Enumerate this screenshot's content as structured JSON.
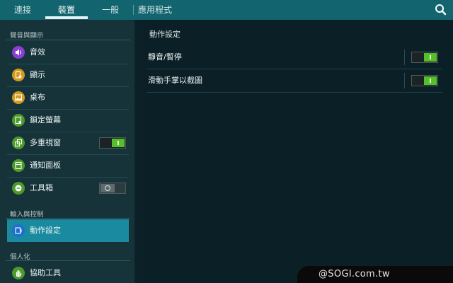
{
  "tabs": [
    {
      "label": "連接",
      "active": false
    },
    {
      "label": "裝置",
      "active": true
    },
    {
      "label": "一般",
      "active": false
    },
    {
      "label": "應用程式",
      "active": false
    }
  ],
  "search_icon": "search-icon",
  "sidebar": {
    "sections": [
      {
        "header": "聲音與顯示",
        "items": [
          {
            "label": "音效",
            "icon": "speaker-icon",
            "color": "#8a3fd1"
          },
          {
            "label": "顯示",
            "icon": "display-icon",
            "color": "#d49a1c"
          },
          {
            "label": "桌布",
            "icon": "wallpaper-icon",
            "color": "#d49a1c"
          },
          {
            "label": "鎖定螢幕",
            "icon": "lock-screen-icon",
            "color": "#4b9a2a"
          },
          {
            "label": "多重視窗",
            "icon": "multi-window-icon",
            "color": "#4b9a2a",
            "toggle": "on"
          },
          {
            "label": "通知面板",
            "icon": "notification-panel-icon",
            "color": "#4b9a2a"
          },
          {
            "label": "工具箱",
            "icon": "toolbox-icon",
            "color": "#4b9a2a",
            "toggle": "off"
          }
        ]
      },
      {
        "header": "輸入與控制",
        "items": [
          {
            "label": "動作設定",
            "icon": "motion-icon",
            "color": "#1f6fd1",
            "selected": true
          }
        ]
      },
      {
        "header": "個人化",
        "items": [
          {
            "label": "協助工具",
            "icon": "hand-icon",
            "color": "#4b9a2a"
          }
        ]
      }
    ]
  },
  "main": {
    "title": "動作設定",
    "rows": [
      {
        "label": "靜音/暫停",
        "toggle": "on"
      },
      {
        "label": "滑動手掌以截圖",
        "toggle": "on"
      }
    ]
  },
  "watermark": "@SOGI.com.tw"
}
